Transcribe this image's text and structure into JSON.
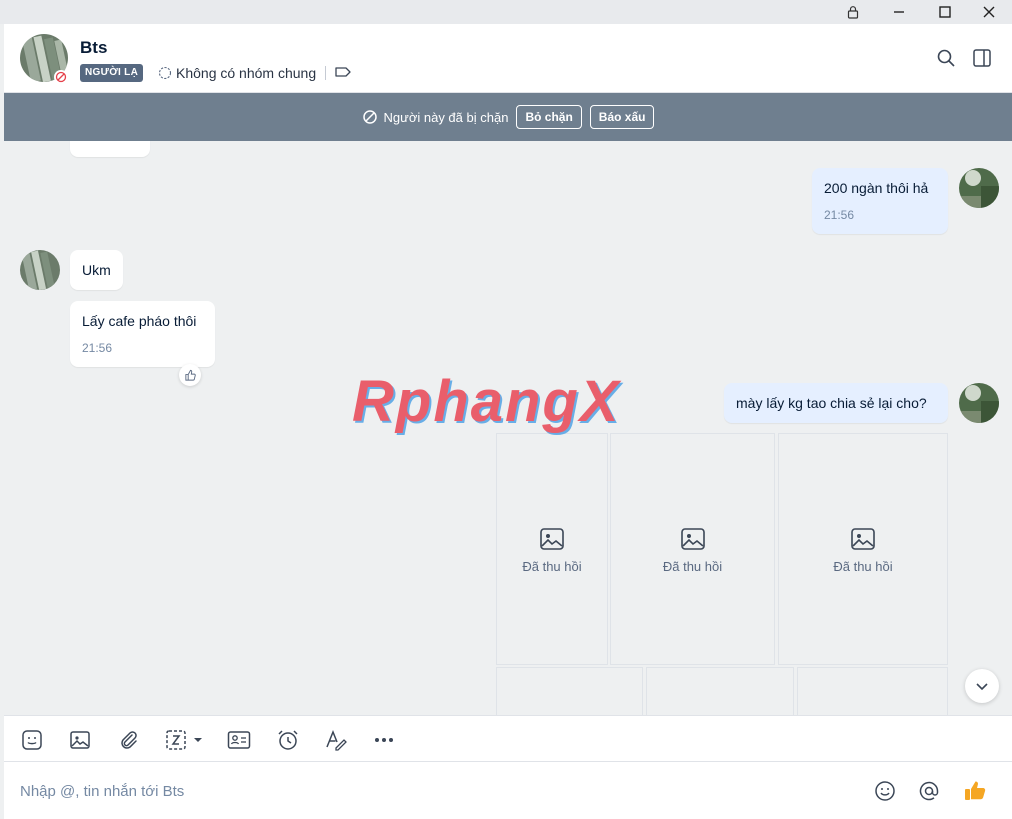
{
  "window": {
    "controls": [
      "lock-icon",
      "minimize-icon",
      "maximize-icon",
      "close-icon"
    ]
  },
  "header": {
    "contact_name": "Bts",
    "stranger_badge": "NGƯỜI LẠ",
    "group_info": "Không có nhóm chung",
    "icons": [
      "search-icon",
      "sidebar-toggle-icon"
    ]
  },
  "blocked_bar": {
    "text": "Người này đã bị chặn",
    "unblock_label": "Bỏ chặn",
    "report_label": "Báo xấu"
  },
  "messages": [
    {
      "sender": "me",
      "text": "200 ngàn thôi hả",
      "time": "21:56"
    },
    {
      "sender": "them",
      "text": "Ukm"
    },
    {
      "sender": "them",
      "text": "Lấy cafe pháo thôi",
      "time": "21:56"
    },
    {
      "sender": "me",
      "text": "mày lấy kg tao chia sẻ lại cho?"
    }
  ],
  "recalled_label": "Đã thu hồi",
  "watermark": "RphangX",
  "toolbar": {
    "tools": [
      "sticker-icon",
      "image-icon",
      "attachment-icon",
      "screenshot-icon",
      "contact-card-icon",
      "reminder-icon",
      "text-format-icon",
      "more-icon"
    ]
  },
  "composer": {
    "placeholder": "Nhập @, tin nhắn tới Bts",
    "value": "",
    "icons": [
      "emoji-icon",
      "mention-icon",
      "thumbs-up-icon"
    ]
  },
  "colors": {
    "blocked_bar": "#6f7f8f",
    "my_bubble": "#e5efff",
    "chat_bg": "#eef0f1",
    "badge": "#566880",
    "like_yellow": "#f5a623"
  }
}
